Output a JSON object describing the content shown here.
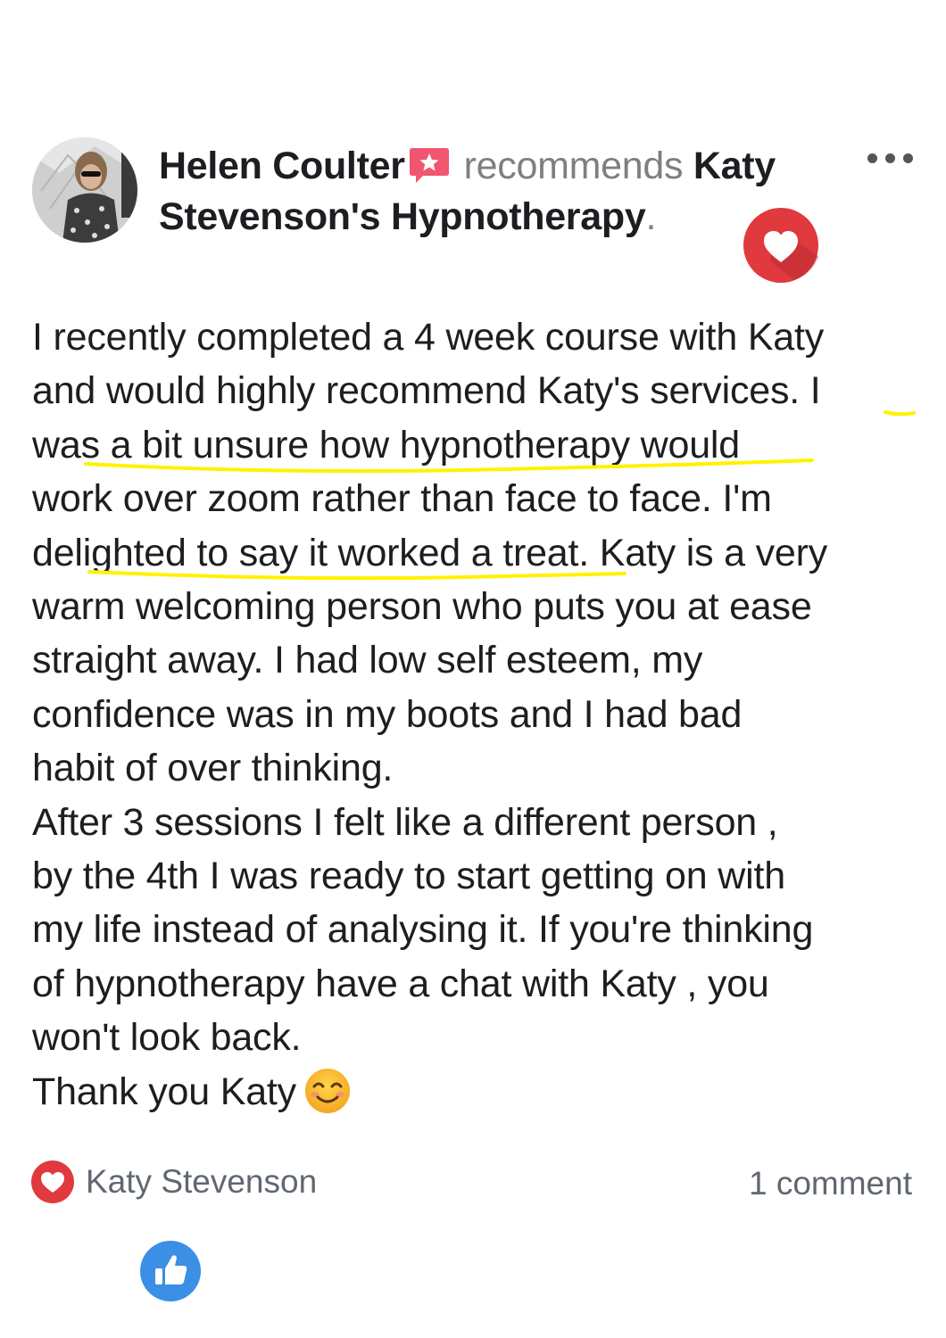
{
  "post": {
    "author": "Helen Coulter",
    "verb": "recommends",
    "page_name": "Katy Stevenson's Hypnotherapy",
    "end_punct": "."
  },
  "icons": {
    "recommend": "recommend-star-icon",
    "more": "more-options-icon",
    "heart_badge": "heart-badge-icon",
    "emoji": "smiling-face-emoji",
    "reaction": "love-reaction-icon",
    "like": "thumbs-up-icon"
  },
  "colors": {
    "heart_red": "#e0393e",
    "recommend_pink": "#f0566f",
    "highlight": "#fff200",
    "like_blue": "#3b8fe5"
  },
  "review": {
    "lines": [
      "I recently completed a 4 week course with Katy",
      "and would highly recommend Katy's services. I",
      "was a bit unsure how hypnotherapy would",
      "work over zoom rather than face to face. I'm",
      "delighted to say it worked a treat. Katy is a very",
      "warm welcoming person who puts you at ease",
      "straight away. I had low self esteem, my",
      "confidence was in my boots and I had bad",
      "habit of over thinking.",
      "After 3 sessions I felt like a different person ,",
      "by the 4th I was ready to start getting on with",
      "my life instead of analysing it. If you're thinking",
      "of hypnotherapy have a chat with Katy , you",
      "won't look back."
    ],
    "closing": "Thank you Katy"
  },
  "footer": {
    "reactor": "Katy Stevenson",
    "comments": "1 comment"
  }
}
